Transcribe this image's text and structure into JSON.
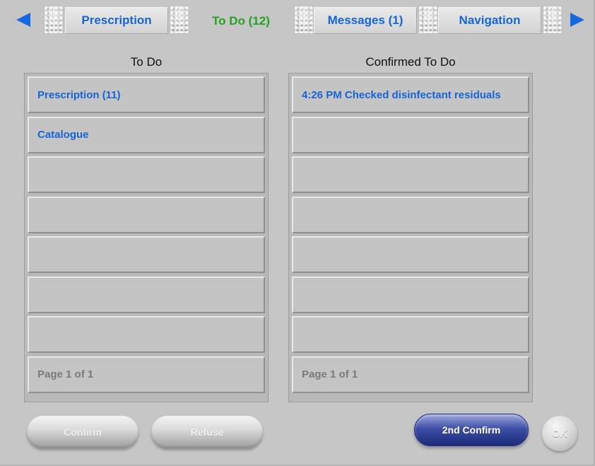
{
  "tabs": [
    {
      "label": "Prescription",
      "active": false
    },
    {
      "label": "To Do (12)",
      "active": true
    },
    {
      "label": "Messages (1)",
      "active": false
    },
    {
      "label": "Navigation",
      "active": false
    }
  ],
  "todo": {
    "title": "To Do",
    "rows": [
      "Prescription (11)",
      "Catalogue",
      "",
      "",
      "",
      "",
      ""
    ],
    "page": "Page 1 of 1"
  },
  "confirmed": {
    "title": "Confirmed To Do",
    "rows": [
      "4:26 PM Checked disinfectant residuals",
      "",
      "",
      "",
      "",
      "",
      ""
    ],
    "page": "Page 1 of 1"
  },
  "buttons": {
    "confirm": "Confirm",
    "refuse": "Refuse",
    "second_confirm": "2nd Confirm",
    "ok": "OK"
  },
  "colors": {
    "background": "#c6c6c6",
    "link_text": "#1565d8",
    "active_tab_text": "#23a123",
    "primary_button": "#2a3a8c"
  },
  "icons": {
    "left": "arrow-left-icon",
    "right": "arrow-right-icon"
  }
}
